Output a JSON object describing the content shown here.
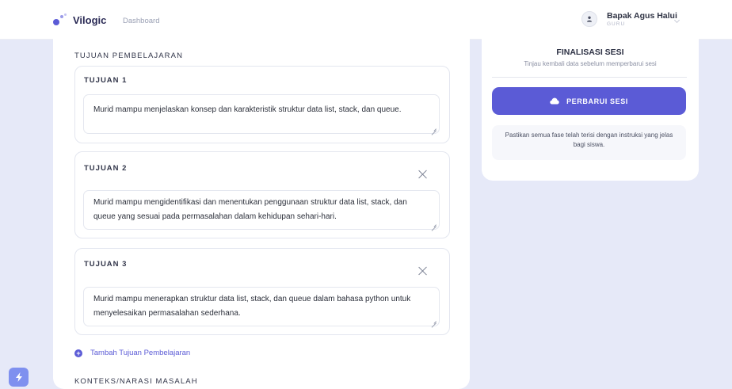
{
  "header": {
    "brand": "Vilogic",
    "nav_dashboard": "Dashboard",
    "user_name": "Bapak Agus Halui",
    "user_role": "GURU"
  },
  "main": {
    "section_title": "TUJUAN PEMBELAJARAN",
    "tujuan": [
      {
        "label": "TUJUAN 1",
        "text": "Murid mampu menjelaskan konsep dan karakteristik struktur data list, stack, dan queue."
      },
      {
        "label": "TUJUAN 2",
        "text": "Murid mampu mengidentifikasi dan menentukan penggunaan struktur data list, stack, dan queue yang sesuai pada permasalahan dalam kehidupan sehari-hari."
      },
      {
        "label": "TUJUAN 3",
        "text": "Murid mampu menerapkan struktur data list, stack, dan queue dalam bahasa python untuk menyelesaikan permasalahan sederhana."
      }
    ],
    "add_label": "Tambah Tujuan Pembelajaran",
    "next_section_title": "KONTEKS/NARASI MASALAH"
  },
  "sidebar": {
    "title": "FINALISASI SESI",
    "subtitle": "Tinjau kembali data sebelum memperbarui sesi",
    "button_label": "PERBARUI SESI",
    "note": "Pastikan semua fase telah terisi dengan instruksi yang jelas bagi siswa."
  },
  "colors": {
    "accent": "#5b5bd6",
    "background": "#e6e9f8"
  },
  "icons": {
    "brand": "vilogic-logo-icon",
    "avatar": "user-icon",
    "close": "close-icon",
    "add": "plus-circle-icon",
    "update": "cloud-icon",
    "float": "lightning-icon"
  }
}
